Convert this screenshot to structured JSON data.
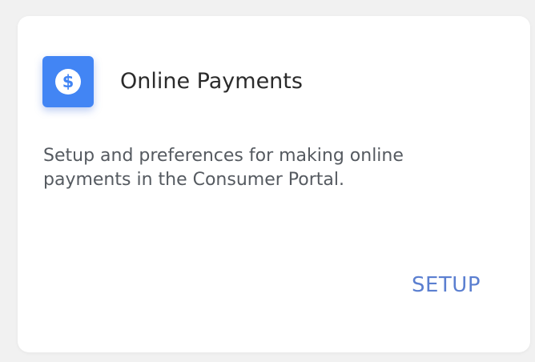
{
  "card": {
    "title": "Online Payments",
    "description": "Setup and preferences for making online payments in the Consumer Portal.",
    "action_label": "SETUP",
    "icon": "dollar-circle-icon"
  },
  "colors": {
    "accent": "#4285f4",
    "action_text": "#5b7fd0"
  }
}
